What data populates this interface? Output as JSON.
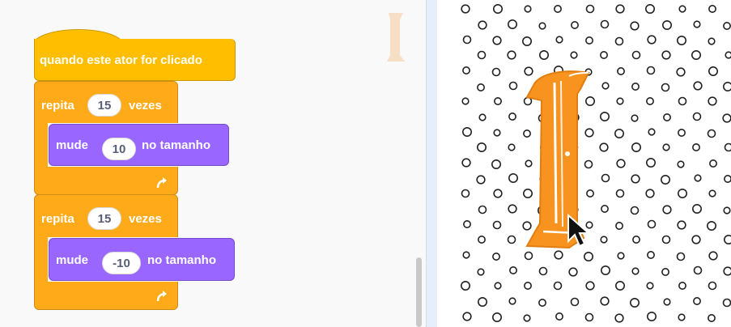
{
  "script": {
    "hat_label": "quando este ator for clicado",
    "loops": [
      {
        "repeat_label": "repita",
        "repeat_count": "15",
        "repeat_suffix": "vezes",
        "inner": {
          "verb": "mude",
          "value": "10",
          "suffix": "no tamanho"
        }
      },
      {
        "repeat_label": "repita",
        "repeat_count": "15",
        "repeat_suffix": "vezes",
        "inner": {
          "verb": "mude",
          "value": "-10",
          "suffix": "no tamanho"
        }
      }
    ]
  },
  "sprite": {
    "icon": "letter-i-sprite"
  },
  "colors": {
    "control": "#ffab19",
    "looks": "#9966ff",
    "hat": "#ffbf00",
    "sprite": "#f7931e"
  }
}
